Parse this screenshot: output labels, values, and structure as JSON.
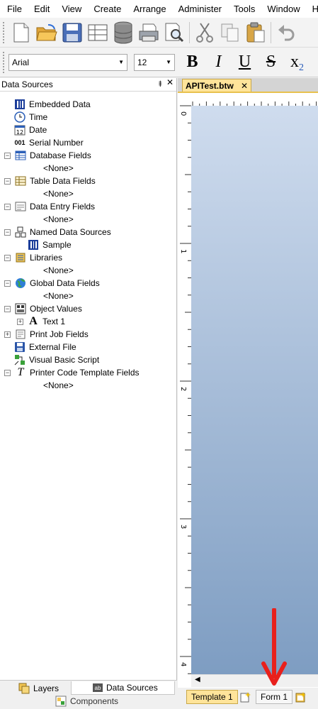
{
  "menu": [
    "File",
    "Edit",
    "View",
    "Create",
    "Arrange",
    "Administer",
    "Tools",
    "Window",
    "Help"
  ],
  "toolbar": {
    "icons": [
      "new-document-icon",
      "open-folder-icon",
      "save-icon",
      "page-setup-icon",
      "database-icon",
      "print-icon",
      "print-preview-icon",
      "cut-icon",
      "copy-icon",
      "paste-icon",
      "undo-icon"
    ]
  },
  "format": {
    "font": "Arial",
    "size": "12",
    "bold": "B",
    "italic": "I",
    "underline": "U",
    "strike": "S",
    "subscript": "x",
    "subscript_digit": "2"
  },
  "panel": {
    "title": "Data Sources",
    "pin": "⯒",
    "close": "✕",
    "items": [
      {
        "label": "Embedded Data"
      },
      {
        "label": "Time"
      },
      {
        "label": "Date"
      },
      {
        "label": "Serial Number"
      },
      {
        "label": "Database Fields"
      },
      {
        "label": "<None>"
      },
      {
        "label": "Table Data Fields"
      },
      {
        "label": "<None>"
      },
      {
        "label": "Data Entry Fields"
      },
      {
        "label": "<None>"
      },
      {
        "label": "Named Data Sources"
      },
      {
        "label": "Sample"
      },
      {
        "label": "Libraries"
      },
      {
        "label": "<None>"
      },
      {
        "label": "Global Data Fields"
      },
      {
        "label": "<None>"
      },
      {
        "label": "Object Values"
      },
      {
        "label": "Text 1"
      },
      {
        "label": "Print Job Fields"
      },
      {
        "label": "External File"
      },
      {
        "label": "Visual Basic Script"
      },
      {
        "label": "Printer Code Template Fields"
      },
      {
        "label": "<None>"
      }
    ],
    "bottom_tabs": {
      "layers": "Layers",
      "data_sources": "Data Sources",
      "components": "Components"
    }
  },
  "document": {
    "tab_title": "APITest.btw",
    "tab_close": "✕",
    "ruler_marks": [
      "0",
      "1",
      "2",
      "3",
      "4"
    ],
    "form_tabs": {
      "template": "Template 1",
      "form": "Form 1"
    }
  },
  "colors": {
    "doc_tab": "#ffe49a",
    "page_top": "#cfdcee",
    "page_bottom": "#7e9dc2",
    "annotation_arrow": "#e8201c"
  }
}
